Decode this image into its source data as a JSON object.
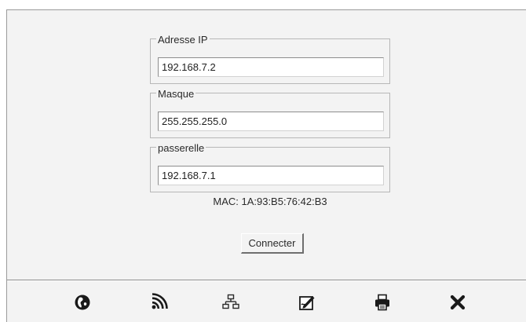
{
  "form": {
    "ip": {
      "legend": "Adresse IP",
      "value": "192.168.7.2"
    },
    "mask": {
      "legend": "Masque",
      "value": "255.255.255.0"
    },
    "gateway": {
      "legend": "passerelle",
      "value": "192.168.7.1"
    },
    "mac": "MAC: 1A:93:B5:76:42:B3",
    "connect_label": "Connecter"
  },
  "toolbar": {
    "icons": [
      "globe-icon",
      "wifi-icon",
      "network-icon",
      "pencil-edit-icon",
      "printer-icon",
      "close-icon"
    ]
  },
  "colors": {
    "panel_background": "#f3f3f3",
    "border": "#b7b7b7",
    "text": "#2a2a2a"
  }
}
